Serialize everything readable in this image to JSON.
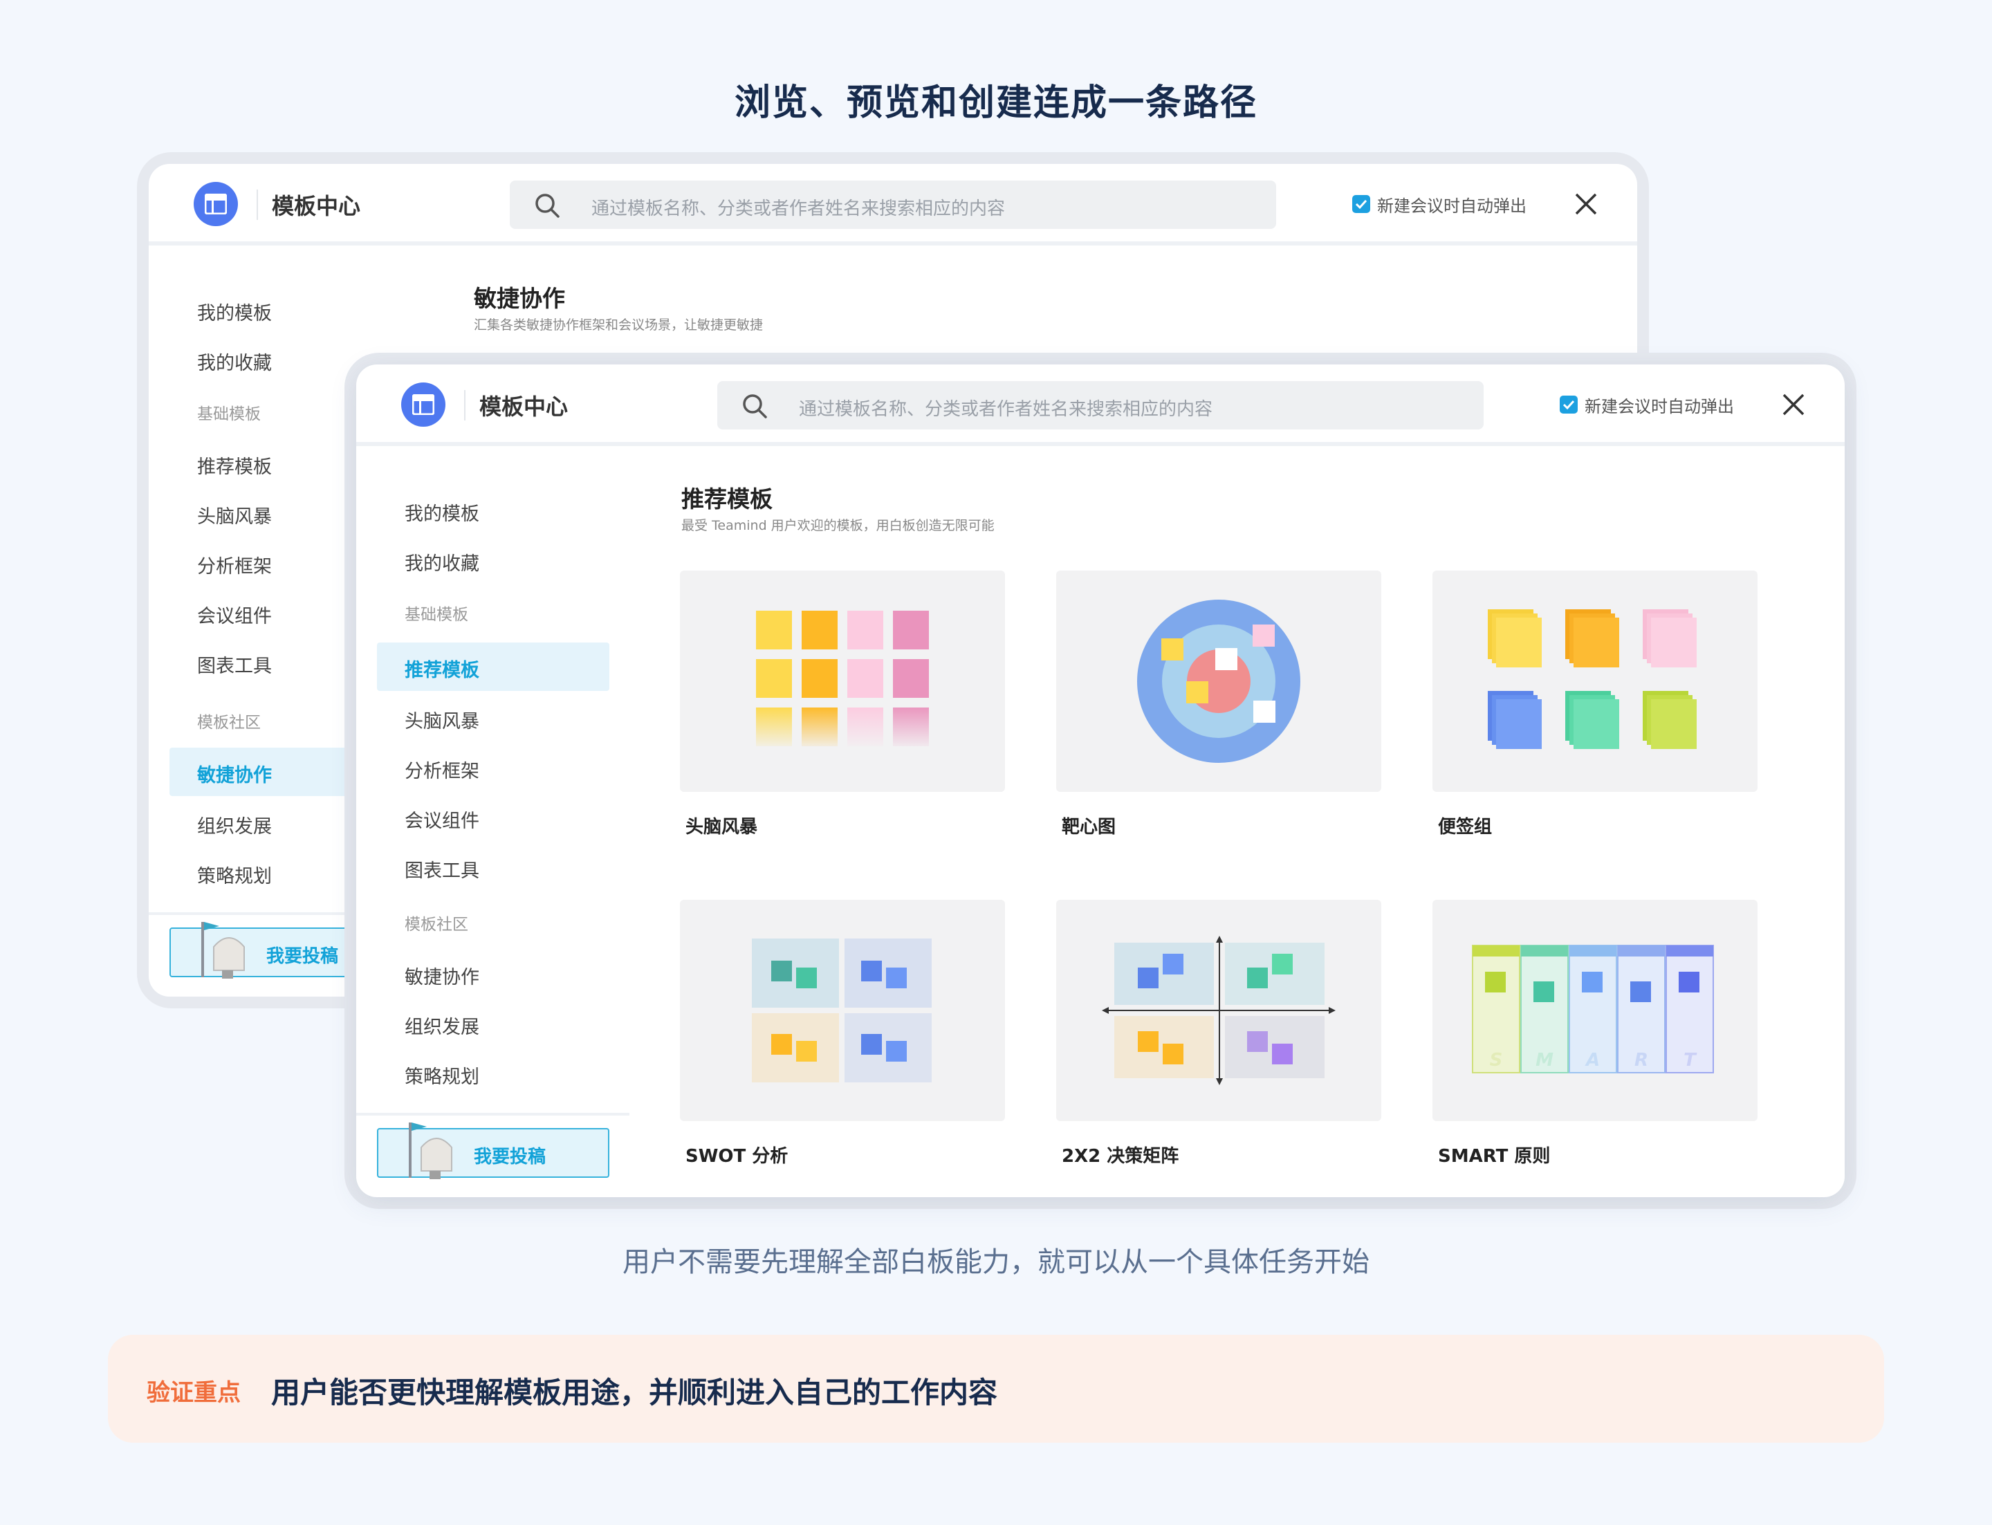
{
  "headline": "浏览、预览和创建连成一条路径",
  "window": {
    "title": "模板中心",
    "search_placeholder": "通过模板名称、分类或者作者姓名来搜索相应的内容",
    "auto_popup_label": "新建会议时自动弹出",
    "auto_popup_checked": true,
    "contribute_label": "我要投稿"
  },
  "sidebar": {
    "my_templates": "我的模板",
    "my_favorites": "我的收藏",
    "group_basic": "基础模板",
    "basic_items": [
      "推荐模板",
      "头脑风暴",
      "分析框架",
      "会议组件",
      "图表工具"
    ],
    "group_community": "模板社区",
    "community_items": [
      "敏捷协作",
      "组织发展",
      "策略规划"
    ]
  },
  "back_window": {
    "active_item": "敏捷协作",
    "section_title": "敏捷协作",
    "section_subtitle": "汇集各类敏捷协作框架和会议场景，让敏捷更敏捷"
  },
  "front_window": {
    "active_item": "推荐模板",
    "section_title": "推荐模板",
    "section_subtitle": "最受 Teamind 用户欢迎的模板，用白板创造无限可能",
    "cards": [
      {
        "name": "头脑风暴",
        "icon": "brainstorm-sticky-grid"
      },
      {
        "name": "靶心图",
        "icon": "target-diagram"
      },
      {
        "name": "便签组",
        "icon": "sticky-note-stacks"
      },
      {
        "name": "SWOT 分析",
        "icon": "swot-quadrants"
      },
      {
        "name": "2X2 决策矩阵",
        "icon": "decision-matrix"
      },
      {
        "name": "SMART 原则",
        "icon": "smart-columns"
      }
    ],
    "smart_letters": [
      "S",
      "M",
      "A",
      "R",
      "T"
    ]
  },
  "caption": "用户不需要先理解全部白板能力，就可以从一个具体任务开始",
  "verify": {
    "label": "验证重点",
    "text": "用户能否更快理解模板用途，并顺利进入自己的工作内容"
  },
  "colors": {
    "accent": "#12a2d8",
    "logo_blue": "#4e78f0",
    "headline": "#172b4d",
    "verify_bg": "#fdf0ea",
    "verify_label": "#f06d3b"
  }
}
